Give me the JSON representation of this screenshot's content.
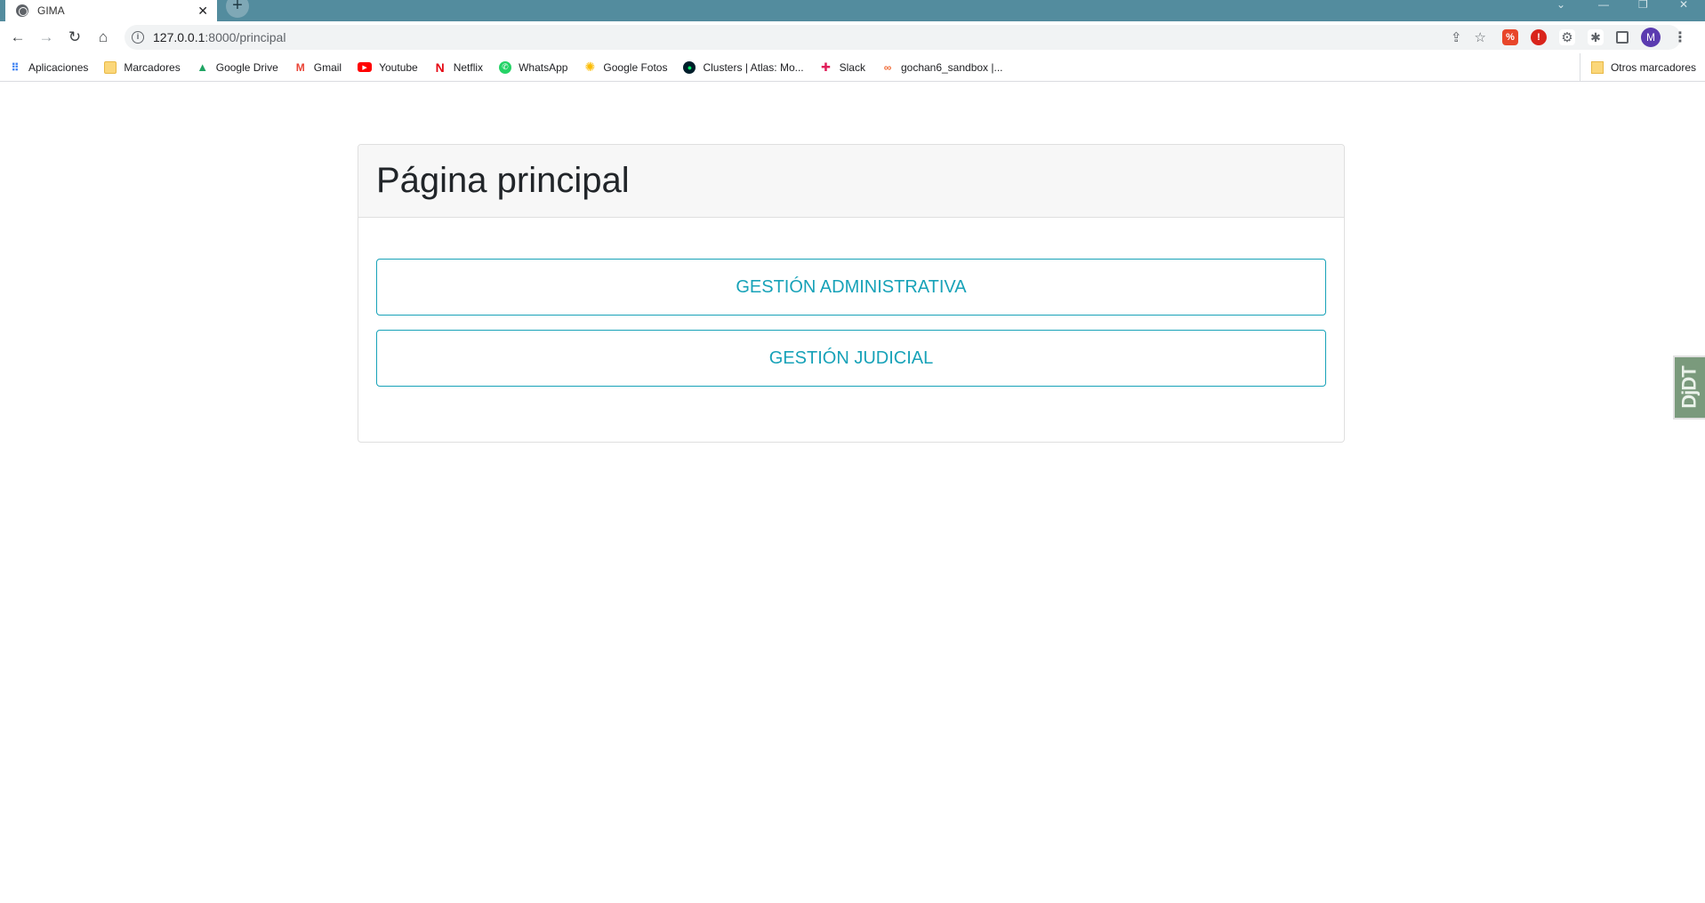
{
  "browser": {
    "tab_title": "GIMA",
    "tab_close": "✕",
    "new_tab": "+",
    "url_host": "127.0.0.1",
    "url_path": ":8000/principal",
    "profile_initial": "M",
    "bookmarks": [
      {
        "label": "Aplicaciones",
        "icon": "apps-grid-icon"
      },
      {
        "label": "Marcadores",
        "icon": "folder-icon"
      },
      {
        "label": "Google Drive",
        "icon": "google-drive-icon"
      },
      {
        "label": "Gmail",
        "icon": "gmail-icon"
      },
      {
        "label": "Youtube",
        "icon": "youtube-icon"
      },
      {
        "label": "Netflix",
        "icon": "netflix-icon"
      },
      {
        "label": "WhatsApp",
        "icon": "whatsapp-icon"
      },
      {
        "label": "Google Fotos",
        "icon": "google-photos-icon"
      },
      {
        "label": "Clusters | Atlas: Mo...",
        "icon": "mongodb-icon"
      },
      {
        "label": "Slack",
        "icon": "slack-icon"
      },
      {
        "label": "gochan6_sandbox |...",
        "icon": "sandbox-icon"
      }
    ],
    "other_bookmarks": "Otros marcadores"
  },
  "page": {
    "title": "Página principal",
    "buttons": {
      "admin": "GESTIÓN ADMINISTRATIVA",
      "judicial": "GESTIÓN JUDICIAL"
    },
    "debug_toolbar": "DjDT"
  },
  "colors": {
    "tabbar": "#538c9e",
    "accent": "#17a2b8",
    "header_bg": "#f7f7f7"
  }
}
